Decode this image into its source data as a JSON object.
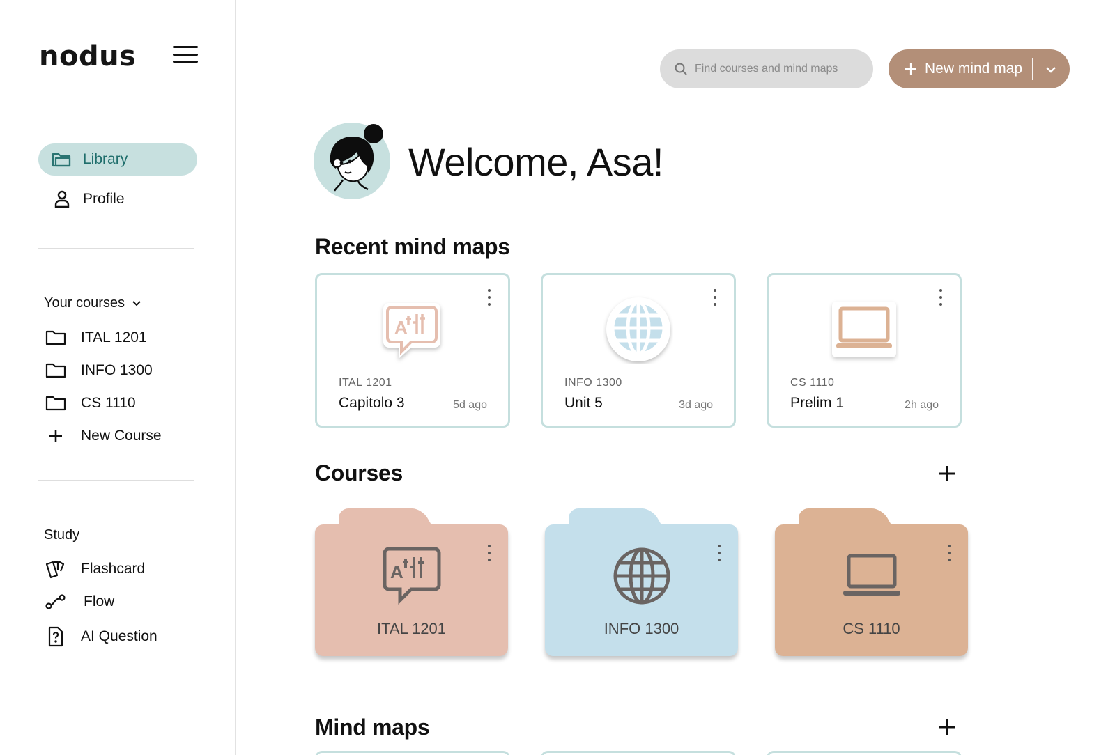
{
  "app": {
    "logo": "nodus"
  },
  "sidebar": {
    "nav": [
      {
        "label": "Library",
        "icon": "folder-open-icon",
        "active": true
      },
      {
        "label": "Profile",
        "icon": "person-icon",
        "active": false
      }
    ],
    "courses_heading": "Your courses",
    "courses": [
      {
        "label": "ITAL 1201",
        "icon": "folder-icon"
      },
      {
        "label": "INFO 1300",
        "icon": "folder-icon"
      },
      {
        "label": "CS 1110",
        "icon": "folder-icon"
      }
    ],
    "new_course_label": "New Course",
    "study_heading": "Study",
    "study": [
      {
        "label": "Flashcard",
        "icon": "cards-icon"
      },
      {
        "label": "Flow",
        "icon": "flow-icon"
      },
      {
        "label": "AI Question",
        "icon": "question-doc-icon"
      }
    ]
  },
  "topbar": {
    "search_placeholder": "Find courses and mind maps",
    "new_button_label": "New mind map"
  },
  "welcome": {
    "greeting": "Welcome, Asa!"
  },
  "recent": {
    "heading": "Recent mind maps",
    "items": [
      {
        "course": "ITAL 1201",
        "title": "Capitolo 3",
        "time": "5d ago",
        "icon": "translate-icon"
      },
      {
        "course": "INFO 1300",
        "title": "Unit 5",
        "time": "3d ago",
        "icon": "globe-icon"
      },
      {
        "course": "CS 1110",
        "title": "Prelim 1",
        "time": "2h ago",
        "icon": "laptop-icon"
      }
    ]
  },
  "courses_section": {
    "heading": "Courses",
    "items": [
      {
        "label": "ITAL 1201",
        "icon": "translate-icon",
        "color": "#e5beaf"
      },
      {
        "label": "INFO 1300",
        "icon": "globe-icon",
        "color": "#c4dfeb"
      },
      {
        "label": "CS 1110",
        "icon": "laptop-icon",
        "color": "#dcb294"
      }
    ]
  },
  "mindmaps_section": {
    "heading": "Mind maps"
  },
  "colors": {
    "accent_teal": "#c7e0df",
    "accent_teal_text": "#1f6e6c",
    "brown_button": "#b38f78",
    "card_border": "#c5dfde"
  }
}
